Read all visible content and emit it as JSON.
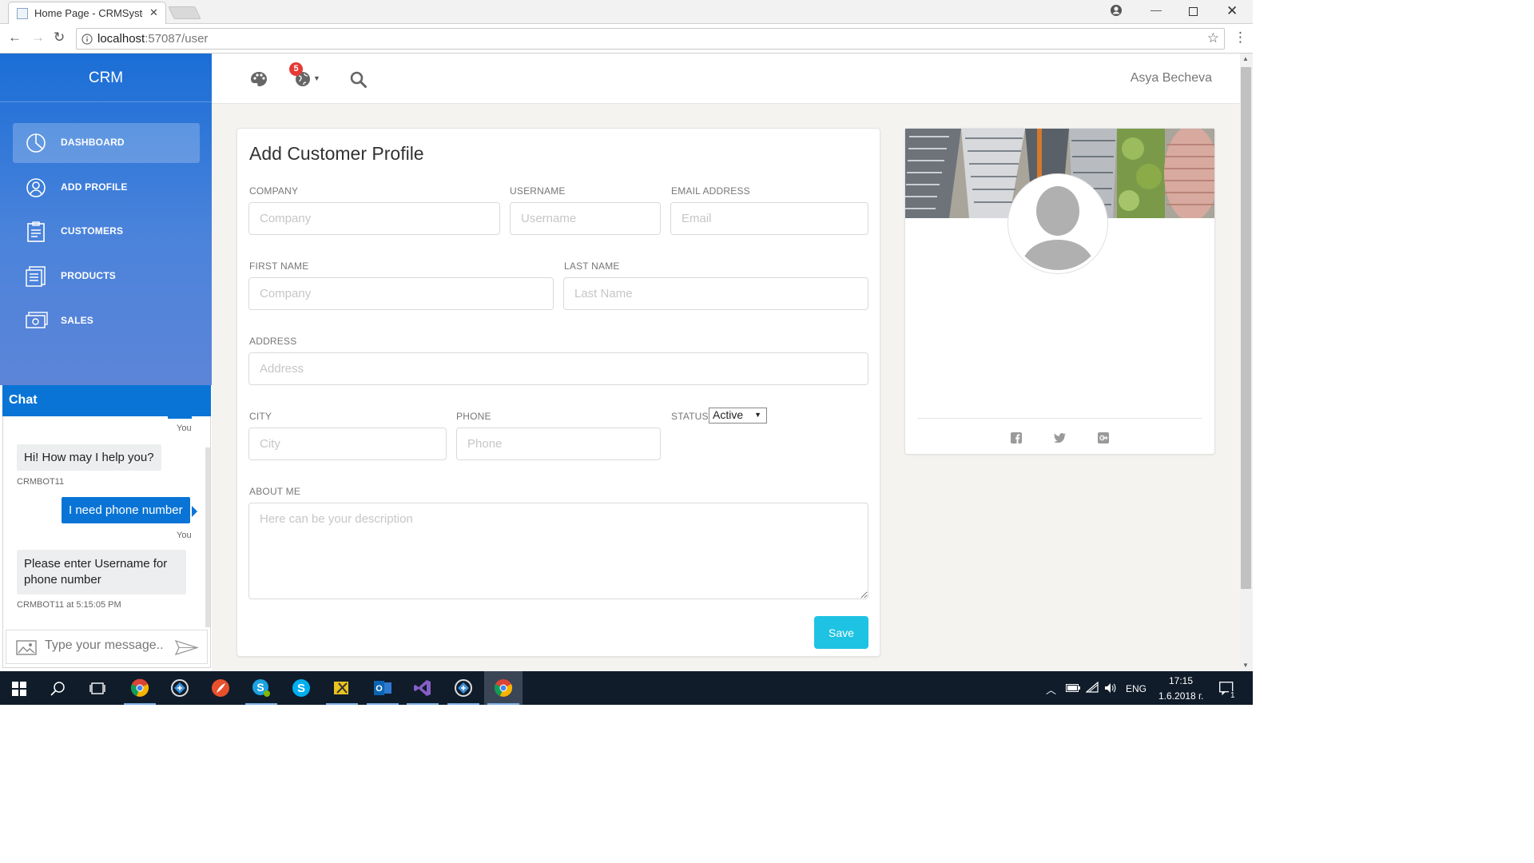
{
  "browser": {
    "tab_title": "Home Page - CRMSystem",
    "url_host": "localhost",
    "url_path": ":57087/user"
  },
  "sidebar": {
    "title": "CRM",
    "items": [
      {
        "label": "DASHBOARD",
        "icon": "pie-chart-icon",
        "active": true
      },
      {
        "label": "ADD PROFILE",
        "icon": "user-icon",
        "active": false
      },
      {
        "label": "CUSTOMERS",
        "icon": "clipboard-icon",
        "active": false
      },
      {
        "label": "PRODUCTS",
        "icon": "list-icon",
        "active": false
      },
      {
        "label": "SALES",
        "icon": "money-icon",
        "active": false
      }
    ]
  },
  "topbar": {
    "notification_count": "5",
    "user_name": "Asya Becheva"
  },
  "form": {
    "title": "Add Customer Profile",
    "company_label": "COMPANY",
    "company_placeholder": "Company",
    "username_label": "USERNAME",
    "username_placeholder": "Username",
    "email_label": "EMAIL ADDRESS",
    "email_placeholder": "Email",
    "first_name_label": "FIRST NAME",
    "first_name_placeholder": "Company",
    "last_name_label": "LAST NAME",
    "last_name_placeholder": "Last Name",
    "address_label": "ADDRESS",
    "address_placeholder": "Address",
    "city_label": "CITY",
    "city_placeholder": "City",
    "phone_label": "PHONE",
    "phone_placeholder": "Phone",
    "status_label": "STATUS",
    "status_value": "Active",
    "about_label": "ABOUT ME",
    "about_placeholder": "Here can be your description",
    "save_label": "Save"
  },
  "chat": {
    "title": "Chat",
    "messages": [
      {
        "from": "me",
        "text": "",
        "meta": "You"
      },
      {
        "from": "bot",
        "text": "Hi! How may I help you?",
        "meta": "CRMBOT11"
      },
      {
        "from": "me",
        "text": "I need phone number",
        "meta": "You"
      },
      {
        "from": "bot",
        "text": "Please enter Username for phone number",
        "meta": "CRMBOT11 at 5:15:05 PM"
      }
    ],
    "input_placeholder": "Type your message..."
  },
  "taskbar": {
    "language": "ENG",
    "time": "17:15",
    "date": "1.6.2018 г.",
    "notification_count": "1"
  },
  "colors": {
    "sidebar_blue": "#1a6ed6",
    "accent_cyan": "#1ec3e3",
    "badge_red": "#e53935",
    "chat_blue": "#0a74d6"
  }
}
